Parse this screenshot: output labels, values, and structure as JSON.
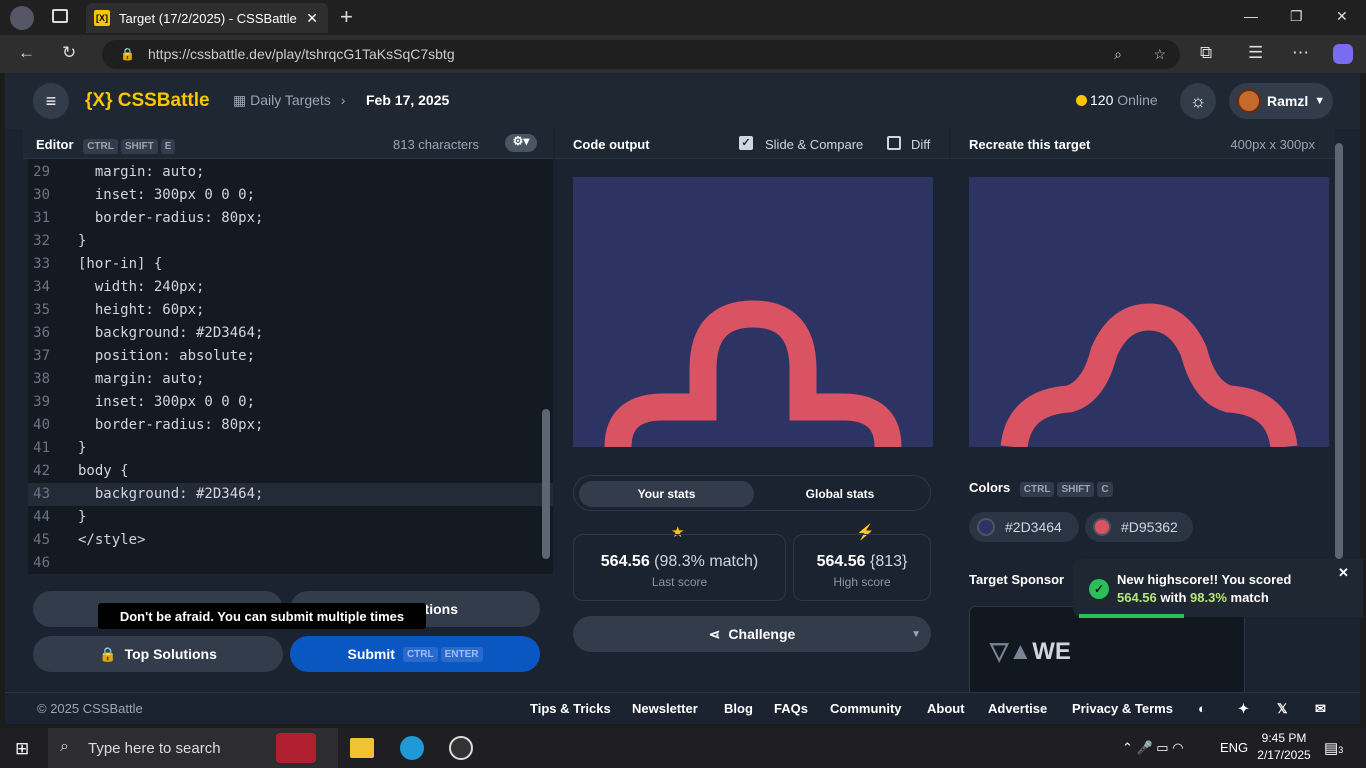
{
  "browser": {
    "tab_title": "Target (17/2/2025) - CSSBattle",
    "tab_favicon": "[X]",
    "url": "https://cssbattle.dev/play/tshrqcG1TaKsSqC7sbtg"
  },
  "header": {
    "logo": "{X} CSSBattle",
    "breadcrumb": "Daily Targets",
    "date": "Feb 17, 2025",
    "online": "120",
    "online_label": "Online",
    "username": "Ramzl"
  },
  "editor": {
    "title": "Editor",
    "kbd": [
      "CTRL",
      "SHIFT",
      "E"
    ],
    "char_count": "813 characters",
    "lines": [
      {
        "n": "29",
        "code": "  margin: auto;"
      },
      {
        "n": "30",
        "code": "  inset: 300px 0 0 0;"
      },
      {
        "n": "31",
        "code": "  border-radius: 80px;"
      },
      {
        "n": "32",
        "code": "}"
      },
      {
        "n": "33",
        "code": "[hor-in] {"
      },
      {
        "n": "34",
        "code": "  width: 240px;"
      },
      {
        "n": "35",
        "code": "  height: 60px;"
      },
      {
        "n": "36",
        "code": "  background: #2D3464;"
      },
      {
        "n": "37",
        "code": "  position: absolute;"
      },
      {
        "n": "38",
        "code": "  margin: auto;"
      },
      {
        "n": "39",
        "code": "  inset: 300px 0 0 0;"
      },
      {
        "n": "40",
        "code": "  border-radius: 80px;"
      },
      {
        "n": "41",
        "code": "}"
      },
      {
        "n": "42",
        "code": "body {"
      },
      {
        "n": "43",
        "code": "  background: #2D3464;"
      },
      {
        "n": "44",
        "code": "}"
      },
      {
        "n": "45",
        "code": "</style>"
      },
      {
        "n": "46",
        "code": ""
      }
    ]
  },
  "actions": {
    "solutions_partial": "tions",
    "tooltip": "Don't be afraid. You can submit multiple times",
    "top_solutions": "Top Solutions",
    "submit": "Submit",
    "submit_kbd": [
      "CTRL",
      "ENTER"
    ]
  },
  "output": {
    "title": "Code output",
    "slide_compare": "Slide & Compare",
    "diff": "Diff",
    "tab_your": "Your stats",
    "tab_global": "Global stats",
    "score": "564.56",
    "match": "(98.3% match)",
    "last_score_label": "Last score",
    "high_score": "564.56",
    "high_chars": "{813}",
    "high_score_label": "High score",
    "challenge": "Challenge"
  },
  "target": {
    "title": "Recreate this target",
    "size": "400px x 300px",
    "colors_label": "Colors",
    "colors_kbd": [
      "CTRL",
      "SHIFT",
      "C"
    ],
    "colors": [
      "#2D3464",
      "#D95362"
    ],
    "sponsor_label": "Target Sponsor",
    "sponsor_name": "WE"
  },
  "toast": {
    "line1": "New highscore!! You scored",
    "score": "564.56",
    "with": "with",
    "match": "98.3%",
    "match_suffix": "match"
  },
  "footer": {
    "copyright": "© 2025 CSSBattle",
    "links": [
      "Tips & Tricks",
      "Newsletter",
      "Blog",
      "FAQs",
      "Community",
      "About",
      "Advertise",
      "Privacy & Terms"
    ]
  },
  "taskbar": {
    "search": "Type here to search",
    "lang": "ENG",
    "time": "9:45 PM",
    "date": "2/17/2025",
    "notif": "3"
  }
}
